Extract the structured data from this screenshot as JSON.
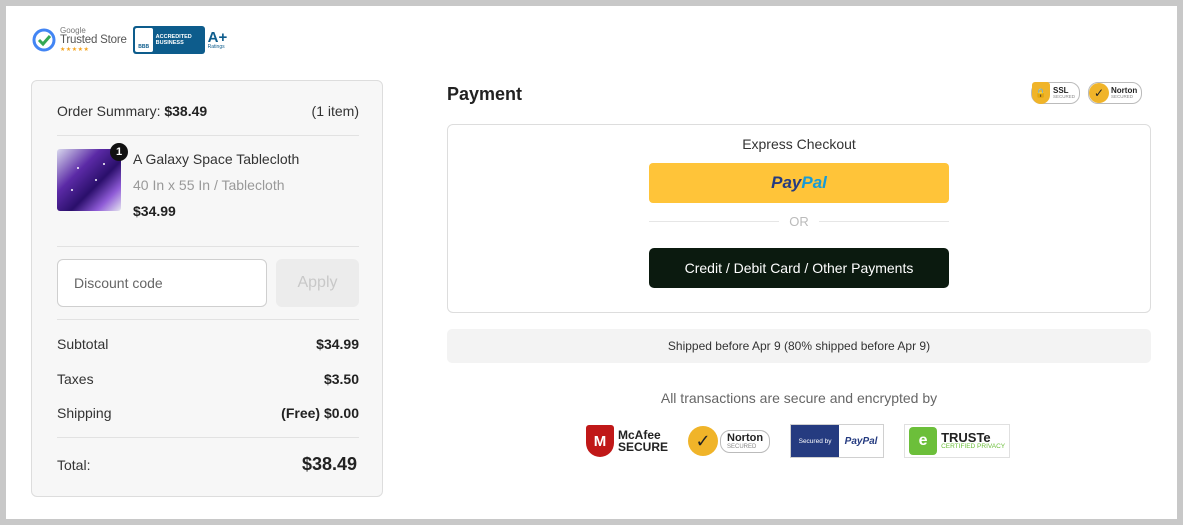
{
  "trust": {
    "google_label": "Google",
    "trusted_store": "Trusted Store",
    "stars": "★★★★★",
    "bbb_text_1": "ACCREDITED",
    "bbb_text_2": "BUSINESS",
    "bbb_logo": "BBB",
    "grade": "A+",
    "ratings": "Ratings"
  },
  "summary": {
    "label": "Order Summary:",
    "total": "$38.49",
    "item_count": "(1 item)",
    "product": {
      "qty": "1",
      "name": "A Galaxy Space Tablecloth",
      "variant": "40 In x 55 In / Tablecloth",
      "price": "$34.99"
    },
    "discount_placeholder": "Discount code",
    "apply_label": "Apply",
    "lines": [
      {
        "label": "Subtotal",
        "value": "$34.99"
      },
      {
        "label": "Taxes",
        "value": "$3.50"
      },
      {
        "label": "Shipping",
        "value": "(Free) $0.00"
      }
    ],
    "total_label": "Total:",
    "total_value": "$38.49"
  },
  "payment": {
    "title": "Payment",
    "ssl_badge": {
      "main": "SSL",
      "sub": "SECURED"
    },
    "norton_badge": {
      "main": "Norton",
      "sub": "SECURED"
    },
    "express_title": "Express Checkout",
    "paypal_part1": "Pay",
    "paypal_part2": "Pal",
    "or_label": "OR",
    "card_button": "Credit / Debit Card / Other Payments",
    "shipping_note": "Shipped before Apr 9 (80% shipped before Apr 9)",
    "secure_text": "All transactions are secure and encrypted by",
    "logos": {
      "mcafee_1": "McAfee",
      "mcafee_2": "SECURE",
      "norton_1": "Norton",
      "norton_2": "SECURED",
      "paypal_secured_left": "Secured by",
      "paypal_secured_right": "PayPal",
      "truste_1": "TRUSTe",
      "truste_2": "CERTIFIED PRIVACY"
    }
  },
  "colors": {
    "paypal_yellow": "#ffc439",
    "dark_button": "#0b1a0f",
    "bbb_blue": "#0d5c8c"
  }
}
